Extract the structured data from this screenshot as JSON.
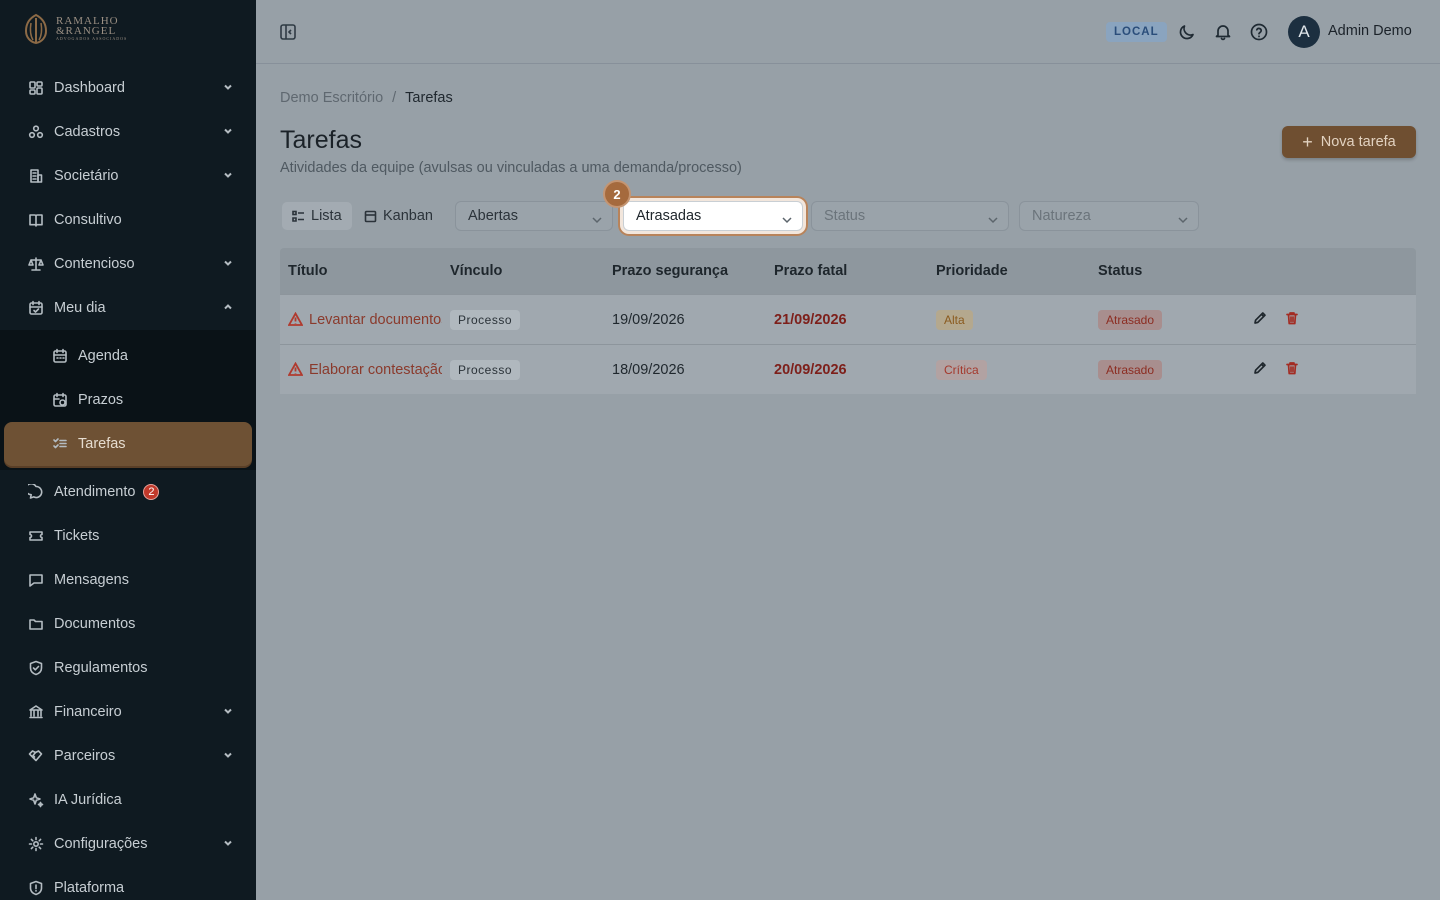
{
  "brand": {
    "line1": "RAMALHO",
    "line2": "&RANGEL",
    "tagline": "ADVOGADOS ASSOCIADOS"
  },
  "sidebar": {
    "items": [
      {
        "label": "Dashboard",
        "icon": "dashboard-icon",
        "chevron": "down"
      },
      {
        "label": "Cadastros",
        "icon": "cadastros-icon",
        "chevron": "down"
      },
      {
        "label": "Societário",
        "icon": "building-icon",
        "chevron": "down"
      },
      {
        "label": "Consultivo",
        "icon": "book-icon"
      },
      {
        "label": "Contencioso",
        "icon": "scale-icon",
        "chevron": "down"
      },
      {
        "label": "Meu dia",
        "icon": "calendar-check-icon",
        "chevron": "up"
      },
      {
        "label": "Atendimento",
        "icon": "chat-icon",
        "badge": "2"
      },
      {
        "label": "Tickets",
        "icon": "ticket-icon"
      },
      {
        "label": "Mensagens",
        "icon": "message-icon"
      },
      {
        "label": "Documentos",
        "icon": "folder-icon"
      },
      {
        "label": "Regulamentos",
        "icon": "shield-icon"
      },
      {
        "label": "Financeiro",
        "icon": "bank-icon",
        "chevron": "down"
      },
      {
        "label": "Parceiros",
        "icon": "handshake-icon",
        "chevron": "down"
      },
      {
        "label": "IA Jurídica",
        "icon": "sparkle-icon"
      },
      {
        "label": "Configurações",
        "icon": "gear-icon",
        "chevron": "down"
      },
      {
        "label": "Plataforma",
        "icon": "shield-alert-icon"
      }
    ],
    "submenu": [
      {
        "label": "Agenda",
        "icon": "calendar-icon"
      },
      {
        "label": "Prazos",
        "icon": "calendar-clock-icon"
      },
      {
        "label": "Tarefas",
        "icon": "list-check-icon",
        "active": true
      }
    ]
  },
  "topbar": {
    "env_badge": "LOCAL",
    "avatar_initial": "A",
    "user_name": "Admin Demo"
  },
  "breadcrumb": {
    "parent": "Demo Escritório",
    "separator": "/",
    "current": "Tarefas"
  },
  "page": {
    "title": "Tarefas",
    "subtitle": "Atividades da equipe (avulsas ou vinculadas a uma demanda/processo)",
    "new_button": "Nova tarefa"
  },
  "filters": {
    "view_list": "Lista",
    "view_kanban": "Kanban",
    "scope": "Abertas",
    "deadline": "Atrasadas",
    "step_badge": "2",
    "status_placeholder": "Status",
    "nature_placeholder": "Natureza"
  },
  "table": {
    "headers": [
      "Título",
      "Vínculo",
      "Prazo segurança",
      "Prazo fatal",
      "Prioridade",
      "Status"
    ],
    "rows": [
      {
        "title": "Levantar documentos",
        "link": "Processo",
        "safety_deadline": "19/09/2026",
        "fatal_deadline": "21/09/2026",
        "priority": "Alta",
        "status": "Atrasado"
      },
      {
        "title": "Elaborar contestação",
        "link": "Processo",
        "safety_deadline": "18/09/2026",
        "fatal_deadline": "20/09/2026",
        "priority": "Crítica",
        "status": "Atrasado"
      }
    ]
  },
  "colors": {
    "sidebar_bg": "#0f1a21",
    "accent": "#6f4f31",
    "danger": "#a32b22"
  }
}
